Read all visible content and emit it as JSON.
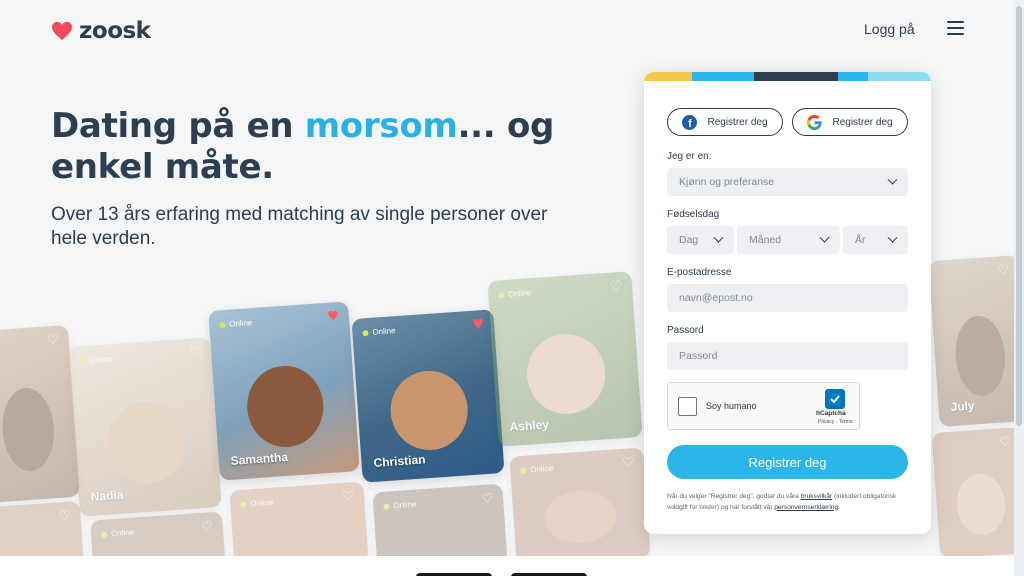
{
  "header": {
    "brand": "zoosk",
    "login_label": "Logg på"
  },
  "hero": {
    "headline_before": "Dating på en ",
    "headline_accent": "morsom",
    "headline_after": "... og enkel måte.",
    "subline": "Over 13 års erfaring med matching av single personer over hele verden."
  },
  "cards": {
    "online_label": "Online",
    "names": {
      "nadia": "Nadia",
      "samantha": "Samantha",
      "christian": "Christian",
      "ashley": "Ashley",
      "july": "July"
    }
  },
  "form": {
    "facebook_label": "Registrer deg",
    "google_label": "Registrer deg",
    "gender_label": "Jeg er en:",
    "gender_value": "Kjønn og preferanse",
    "birthday_label": "Fødselsdag",
    "day_value": "Dag",
    "month_value": "Måned",
    "year_value": "År",
    "email_label": "E-postadresse",
    "email_placeholder": "navn@epost.no",
    "password_label": "Passord",
    "password_placeholder": "Passord",
    "captcha_label": "Soy humano",
    "captcha_brand": "hCaptcha",
    "captcha_links": "Privacy - Terms",
    "submit_label": "Registrer deg",
    "legal_prefix": "Når du velger \"Registrer deg\", godtar du våre ",
    "legal_terms": "bruksvilkår",
    "legal_middle": " (inkludert obligatorisk voldgift for tvister) og har forstått vår ",
    "legal_privacy": "personvernserklæring",
    "legal_suffix": "."
  },
  "colors": {
    "accent": "#29b1e6",
    "button": "#2bb5e8",
    "heart": "#f24c5a",
    "text": "#2d3e50"
  }
}
